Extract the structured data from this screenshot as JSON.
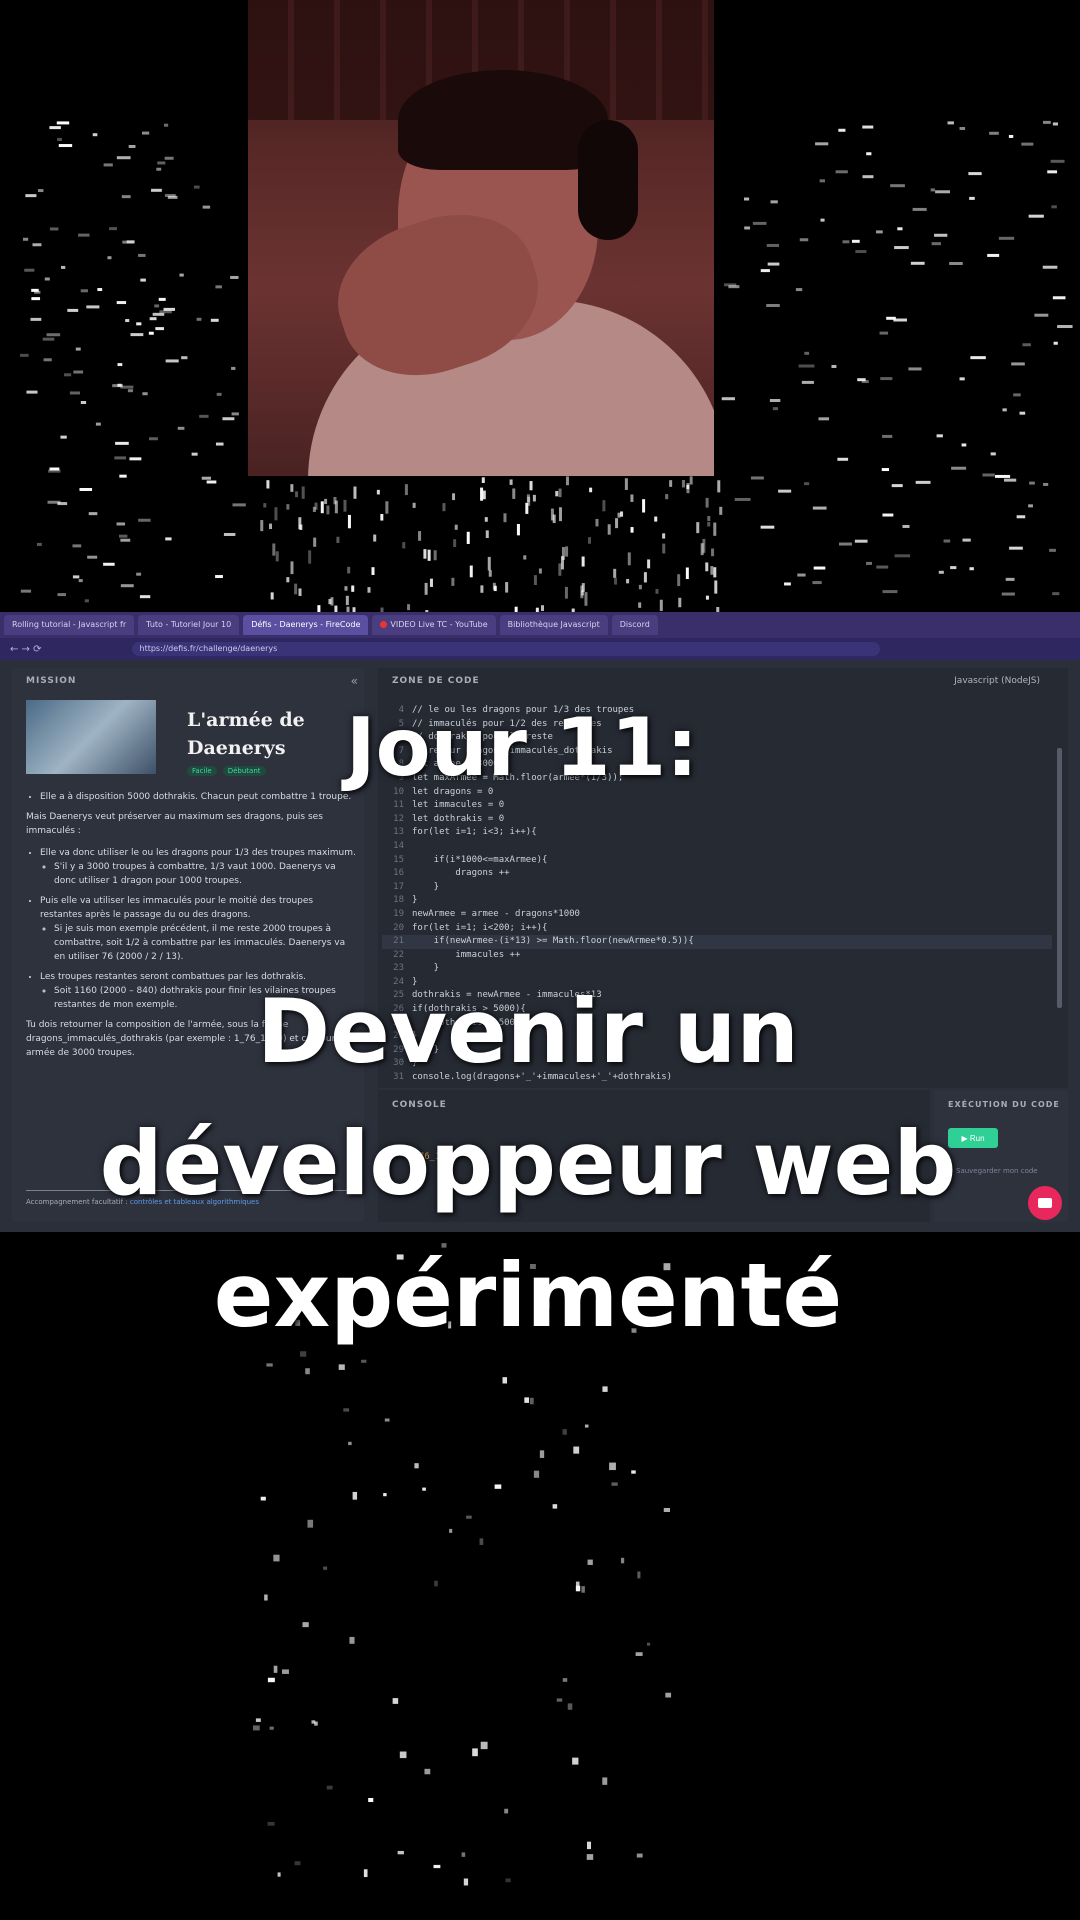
{
  "browser": {
    "tabs": [
      "Rolling tutorial - Javascript fr",
      "Tuto - Tutoriel Jour 10",
      "Défis - Daenerys - FireCode",
      "VIDEO Live TC - YouTube",
      "Bibliothèque Javascript",
      "Discord"
    ],
    "active_tab_index": 2,
    "youtube_tab_index": 3,
    "url": "https://defis.fr/challenge/daenerys",
    "nav_glyphs": "← → ⟳"
  },
  "mission": {
    "heading": "MISSION",
    "collapse_glyph": "«",
    "title": "L'armée de Daenerys",
    "tags": [
      "Facile",
      "Débutant"
    ],
    "bullets_top": [
      "Elle a à disposition 5000 dothrakis. Chacun peut combattre 1 troupe."
    ],
    "intro": "Mais Daenerys veut préserver au maximum ses dragons, puis ses immaculés :",
    "bullets": [
      "Elle va donc utiliser le ou les dragons pour 1/3 des troupes maximum.",
      "S'il y a 3000 troupes à combattre, 1/3 vaut 1000. Daenerys va donc utiliser 1 dragon pour 1000 troupes.",
      "Puis elle va utiliser les immaculés pour le moitié des troupes restantes après le passage du ou des dragons.",
      "Si je suis mon exemple précédent, il me reste 2000 troupes à combattre, soit 1/2 à combattre par les immaculés. Daenerys va en utiliser 76 (2000 / 2 / 13).",
      "Les troupes restantes seront combattues par les dothrakis.",
      "Soit 1160 (2000 – 840) dothrakis pour finir les vilaines troupes restantes de mon exemple."
    ],
    "closing": "Tu dois retourner la composition de l'armée, sous la forme dragons_immaculés_dothrakis (par exemple : 1_76_1160) et ce pour une armée de 3000 troupes.",
    "footer_prefix": "Accompagnement facultatif : ",
    "footer_link": "contrôles et tableaux algorithmiques"
  },
  "editor": {
    "heading": "ZONE DE CODE",
    "language": "Javascript (NodeJS)",
    "lines": [
      {
        "n": "4",
        "code": "// le ou les dragons pour 1/3 des troupes"
      },
      {
        "n": "5",
        "code": "// immaculés pour 1/2 des restantes"
      },
      {
        "n": "6",
        "code": "// dothrakis pour le reste"
      },
      {
        "n": "7",
        "code": "// retour dragons_immaculés_dothrakis"
      },
      {
        "n": "8",
        "code": "let armee = 3000"
      },
      {
        "n": "9",
        "code": "let maxArmee = Math.floor(armee*(1/3));"
      },
      {
        "n": "10",
        "code": "let dragons = 0"
      },
      {
        "n": "11",
        "code": "let immacules = 0"
      },
      {
        "n": "12",
        "code": "let dothrakis = 0"
      },
      {
        "n": "13",
        "code": "for(let i=1; i<3; i++){"
      },
      {
        "n": "14",
        "code": ""
      },
      {
        "n": "15",
        "code": "    if(i*1000<=maxArmee){"
      },
      {
        "n": "16",
        "code": "        dragons ++"
      },
      {
        "n": "17",
        "code": "    }"
      },
      {
        "n": "18",
        "code": "}"
      },
      {
        "n": "19",
        "code": "newArmee = armee - dragons*1000"
      },
      {
        "n": "20",
        "code": "for(let i=1; i<200; i++){"
      },
      {
        "n": "21",
        "code": "    if(newArmee-(i*13) >= Math.floor(newArmee*0.5)){"
      },
      {
        "n": "22",
        "code": "        immacules ++"
      },
      {
        "n": "23",
        "code": "    }"
      },
      {
        "n": "24",
        "code": "}"
      },
      {
        "n": "25",
        "code": "dothrakis = newArmee - immacules*13"
      },
      {
        "n": "26",
        "code": "if(dothrakis > 5000){"
      },
      {
        "n": "27",
        "code": "    dothrakis = 5000"
      },
      {
        "n": "28",
        "code": "}"
      },
      {
        "n": "29",
        "code": "    }"
      },
      {
        "n": "30",
        "code": "}"
      },
      {
        "n": "31",
        "code": "console.log(dragons+'_'+immacules+'_'+dothrakis)"
      }
    ],
    "highlight_line": "21"
  },
  "console": {
    "heading": "CONSOLE",
    "output": "1_76_1160"
  },
  "execution": {
    "heading": "EXÉCUTION DU CODE",
    "run_label": "▶ Run",
    "save_label": "Sauvegarder mon code"
  },
  "overlay": {
    "line1": "Jour 11:",
    "line2": "Devenir un",
    "line3": "développeur web",
    "line4": "expérimenté"
  },
  "colors": {
    "background": "#000000",
    "browser_chrome": "#3a2f6b",
    "editor_bg": "#262a33",
    "panel_bg": "#2e323d",
    "run_button": "#2fcf95",
    "chat_bubble": "#e8285c"
  },
  "icons": {
    "chat": "chat-bubble-icon",
    "collapse": "collapse-icon",
    "settings": "gear-icon"
  }
}
